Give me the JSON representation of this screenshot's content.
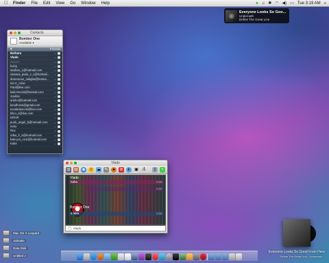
{
  "menubar": {
    "apple": "",
    "items": [
      "Finder",
      "File",
      "Edit",
      "View",
      "Go",
      "Window",
      "Help"
    ],
    "clock": "Tue 3:19 AM"
  },
  "growl": {
    "title": "Everyone Looks So Goo...",
    "artist": "Underoath",
    "album": "Define The Great Line"
  },
  "contacts": {
    "window_title": "Contacts",
    "me_name": "Bomber One",
    "me_status": "Available ▾",
    "groups": [
      {
        "label": "▼",
        "right": "Friends"
      }
    ],
    "rows": [
      {
        "name": "Barbara",
        "style": "bold"
      },
      {
        "name": "Vlado",
        "style": "bold"
      },
      {
        "name": "Search",
        "style": "dim"
      },
      {
        "name": "fuzzy",
        "style": ""
      },
      {
        "name": "starbes_1@hotmail.com",
        "style": ""
      },
      {
        "name": "samara_pudo_v_c@hotmail...",
        "style": ""
      },
      {
        "name": "donnomus_sakgba@hotma...",
        "style": ""
      },
      {
        "name": "nix-C_nrise",
        "style": ""
      },
      {
        "name": "Paul@live.com",
        "style": ""
      },
      {
        "name": "kale-trex15@hotmail.com",
        "style": ""
      },
      {
        "name": "Joalina",
        "style": ""
      },
      {
        "name": "arieko@hotmail.com",
        "style": ""
      },
      {
        "name": "kesdfrossi@gmail.com",
        "style": ""
      },
      {
        "name": "ea.takotat-ots@live.com",
        "style": ""
      },
      {
        "name": "kitco_s@live.com",
        "style": ""
      },
      {
        "name": "DrEvR",
        "style": ""
      },
      {
        "name": "punk_angel_b@hotmail.com",
        "style": ""
      },
      {
        "name": "neko",
        "style": ""
      },
      {
        "name": "Rux",
        "style": ""
      },
      {
        "name": "mika_h_5@hotmail.com",
        "style": ""
      },
      {
        "name": "kale-jon_rock@hotmail.com",
        "style": ""
      },
      {
        "name": "Kake",
        "style": ""
      }
    ],
    "row_hint": "•••"
  },
  "chat": {
    "window_title": "Vlado",
    "header_top": "Vlado",
    "msg1": "haha",
    "msg1_time": "2:18",
    "msg2_time": "2:18",
    "header_bottom": "Bomber One",
    "msg3": "a laka",
    "msg3_time": "2:18",
    "to_label": "Vlado"
  },
  "desktop_icons": [
    "Mac OS X Leopard",
    "Jalmake",
    "Data Disk",
    "Untitled 2"
  ],
  "now_playing": {
    "title": "Everyone Looks So Good From Here",
    "subtitle": "Define The Great Line - Underoath"
  }
}
